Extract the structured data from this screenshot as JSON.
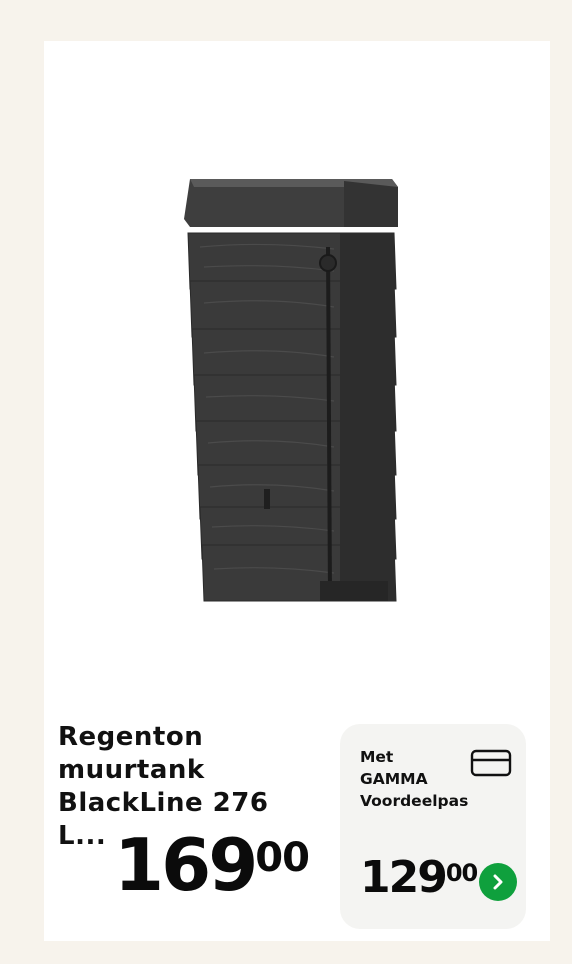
{
  "product": {
    "title": "Regenton\nmuurtank\nBlackLine 276 L...",
    "price_int": "169",
    "price_dec": "00"
  },
  "promo": {
    "label": "Met\nGAMMA\nVoordeelpas",
    "price_int": "129",
    "price_dec": "00"
  },
  "colors": {
    "background": "#f7f3ec",
    "card": "#ffffff",
    "promo_panel": "#f4f4f2",
    "accent_green": "#0fa03d",
    "tank": "#3a3a3a"
  },
  "icons": {
    "loyalty_card": "credit-card-icon",
    "next": "chevron-right-icon"
  }
}
